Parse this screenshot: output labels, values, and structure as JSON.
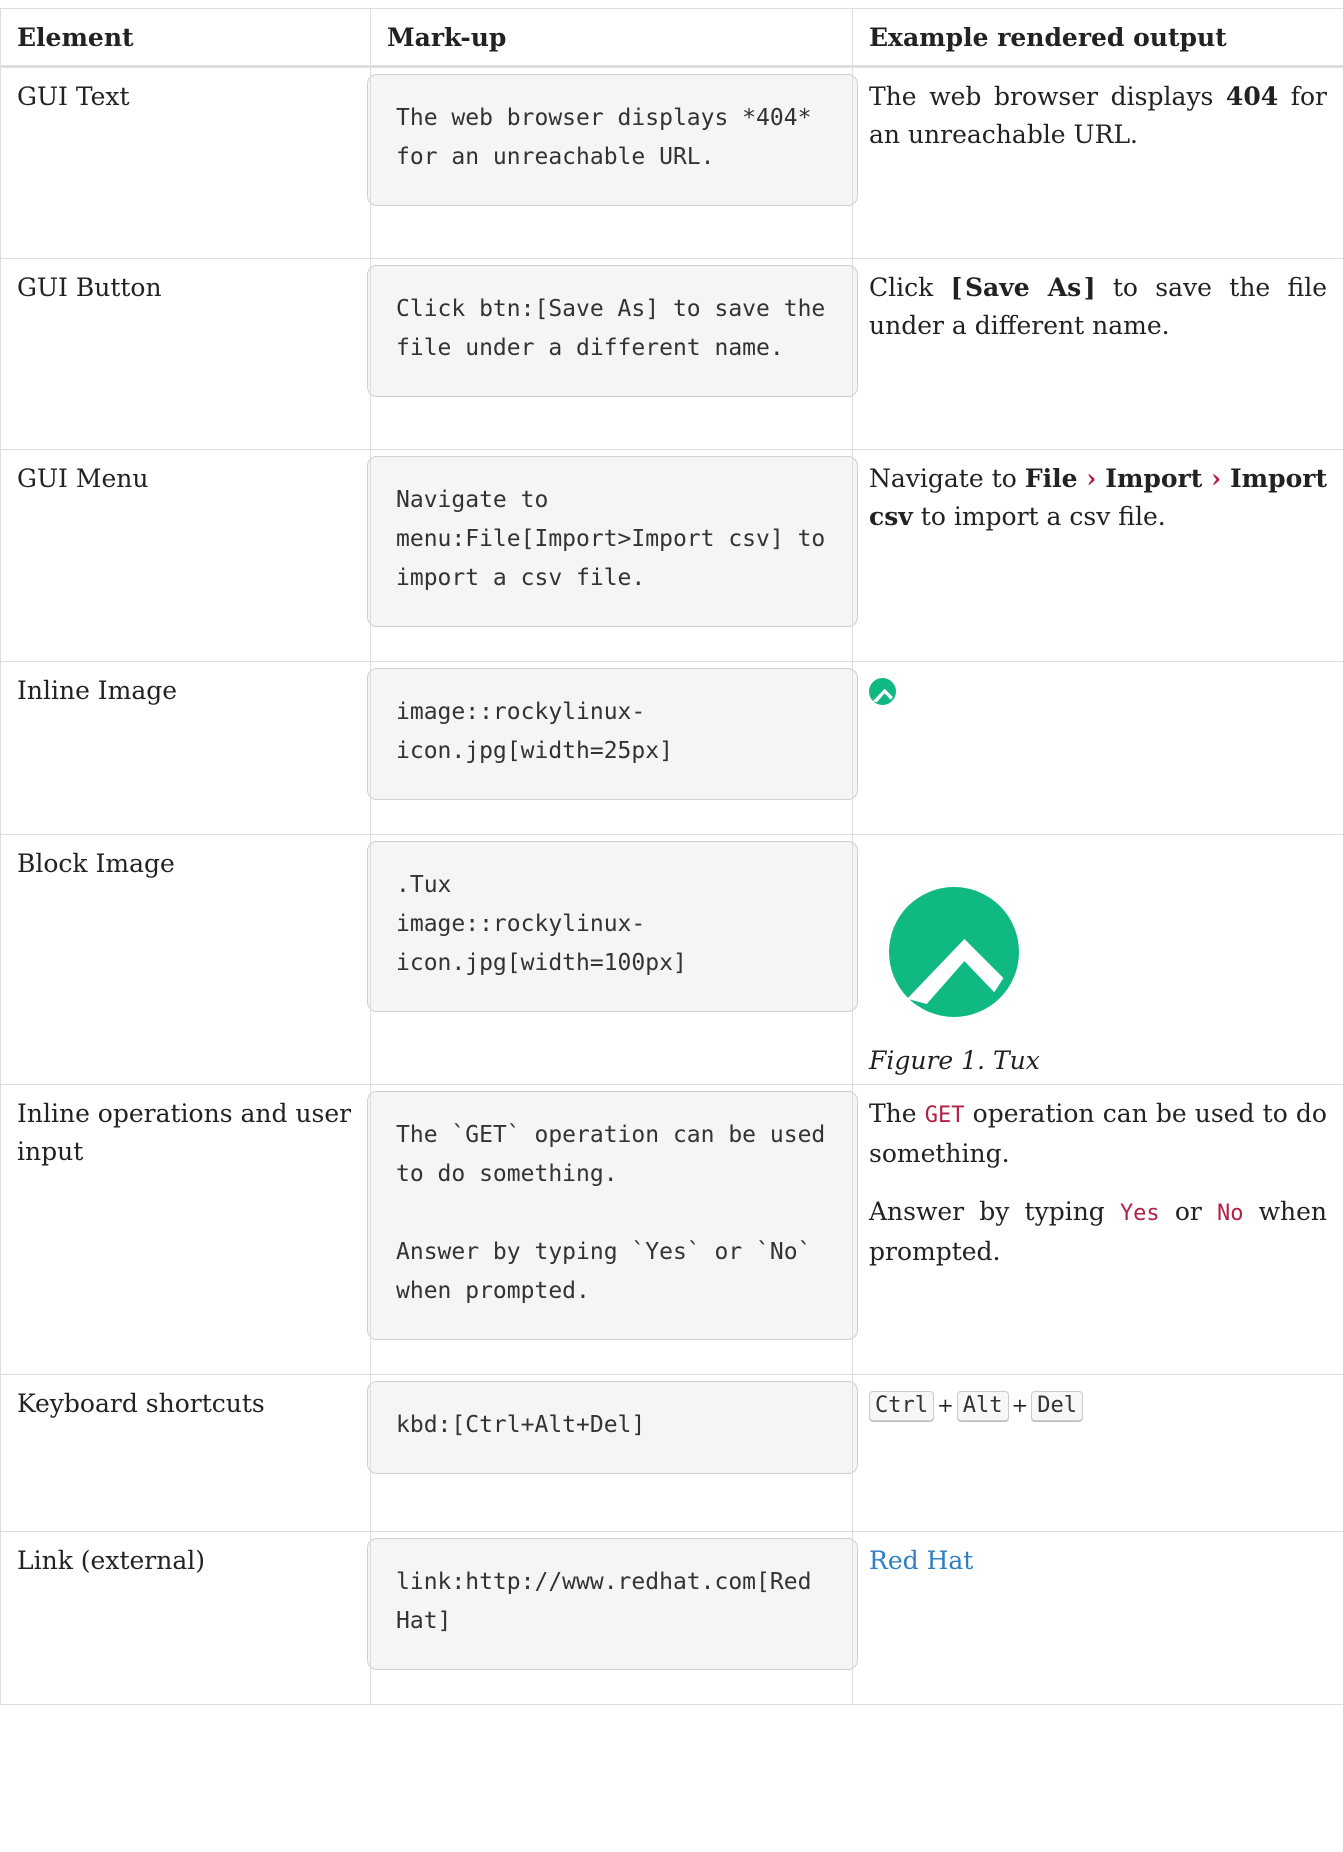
{
  "headers": [
    "Element",
    "Mark-up",
    "Example rendered output"
  ],
  "rows": [
    {
      "element": "GUI Text",
      "markup": [
        "The web browser displays *404* for an unreachable URL."
      ],
      "out_pre": "The web browser displays ",
      "out_strong": "404",
      "out_post": " for an unreachable URL."
    },
    {
      "element": "GUI Button",
      "markup": [
        "Click btn:[Save As] to save the file under a different name."
      ],
      "out_pre": "Click ",
      "btn_open": "[",
      "btn_label": "Save As",
      "btn_close": "]",
      "out_post": " to save the file under a different name."
    },
    {
      "element": "GUI Menu",
      "markup": [
        "Navigate to menu:File[Import>Import csv] to import a csv file."
      ],
      "out_pre": "Navigate to ",
      "menu_items": [
        "File",
        "Import",
        "Import csv"
      ],
      "caret": "›",
      "out_post": " to import a csv file."
    },
    {
      "element": "Inline Image",
      "markup": [
        "image::rockylinux-icon.jpg[width=25px]"
      ]
    },
    {
      "element": "Block Image",
      "markup": [
        ".Tux\nimage::rockylinux-icon.jpg[width=100px]"
      ],
      "figure_caption": "Figure 1. Tux"
    },
    {
      "element": "Inline operations and user input",
      "markup": [
        "The `GET` operation can be used to do something.",
        "Answer by typing `Yes` or `No` when prompted."
      ],
      "p1_pre": "The ",
      "p1_code": "GET",
      "p1_post": " operation can be used to do something.",
      "p2_pre": "Answer by typing ",
      "p2_code1": "Yes",
      "p2_mid": " or ",
      "p2_code2": "No",
      "p2_post": " when prompted."
    },
    {
      "element": "Keyboard shortcuts",
      "markup": [
        "kbd:[Ctrl+Alt+Del]"
      ],
      "keys": [
        "Ctrl",
        "Alt",
        "Del"
      ],
      "plus": "+"
    },
    {
      "element": "Link (external)",
      "markup": [
        "link:http://www.redhat.com[Red Hat]"
      ],
      "link_text": "Red Hat"
    }
  ],
  "colors": {
    "logo_green": "#10b981",
    "code_red": "#b12146",
    "link_blue": "#2f7dc3",
    "code_bg": "#f5f5f5"
  },
  "icons": [
    "rocky-linux-logo-icon"
  ]
}
